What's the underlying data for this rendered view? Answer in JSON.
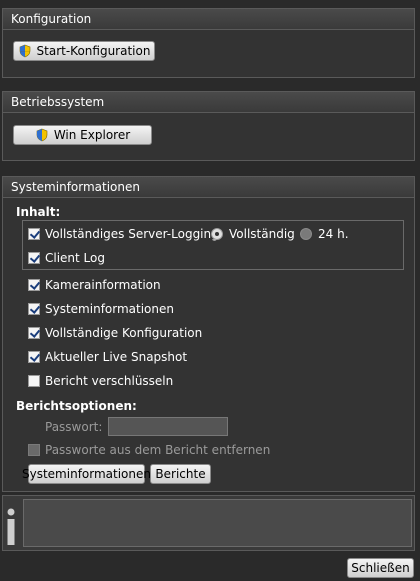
{
  "konfiguration": {
    "title": "Konfiguration",
    "start_button": "Start-Konfiguration"
  },
  "betriebssystem": {
    "title": "Betriebssystem",
    "explorer_button": "Win Explorer"
  },
  "systeminfo": {
    "title": "Systeminformationen",
    "inhalt_label": "Inhalt:",
    "server_logging": {
      "label": "Vollständiges Server-Logging",
      "checked": true
    },
    "radio_full": {
      "label": "Vollständig",
      "selected": true
    },
    "radio_24h": {
      "label": "24 h.",
      "selected": false
    },
    "client_log": {
      "label": "Client Log",
      "checked": true
    },
    "kamera": {
      "label": "Kamerainformation",
      "checked": true
    },
    "sysinfo": {
      "label": "Systeminformationen",
      "checked": true
    },
    "konfig": {
      "label": "Vollständige Konfiguration",
      "checked": true
    },
    "snapshot": {
      "label": "Aktueller Live Snapshot",
      "checked": true
    },
    "encrypt": {
      "label": "Bericht verschlüsseln",
      "checked": false
    },
    "options_label": "Berichtsoptionen:",
    "password_label": "Passwort:",
    "password_value": "",
    "remove_passwords": {
      "label": "Passworte aus dem Bericht entfernen",
      "checked": false
    },
    "sysinfo_button": "Systeminformationen",
    "reports_button": "Berichte"
  },
  "info": {
    "icon": "info-icon",
    "message": ""
  },
  "footer": {
    "close_button": "Schließen"
  },
  "colors": {
    "background": "#2a2a2a",
    "panel": "#333333",
    "border": "#5a5a5a",
    "text": "#ffffff",
    "disabled_text": "#9a9a9a"
  }
}
